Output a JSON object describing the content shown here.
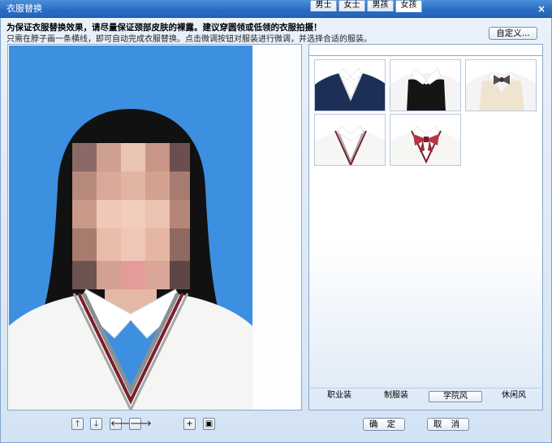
{
  "window": {
    "title": "衣服替换",
    "close_glyph": "×"
  },
  "hints": {
    "bold": "为保证衣服替换效果，请尽量保证颈部皮肤的裸露。建议穿圆领或低领的衣服拍摄！",
    "normal": "只需在脖子画一条横线，即可自动完成衣服替换。点击微调按钮对服装进行微调，并选择合适的服装。"
  },
  "custom_button": "自定义...",
  "tabs": [
    {
      "label": "男士",
      "active": false
    },
    {
      "label": "女士",
      "active": false
    },
    {
      "label": "男孩",
      "active": false
    },
    {
      "label": "女孩",
      "active": true
    }
  ],
  "thumbnails": [
    {
      "id": "navy-vest",
      "icon": "navy-vest-uniform-image"
    },
    {
      "id": "black-vest",
      "icon": "black-vest-uniform-image"
    },
    {
      "id": "beige-bow-vest",
      "icon": "beige-vest-bow-uniform-image"
    },
    {
      "id": "white-sweater-maroon",
      "icon": "white-sweater-uniform-image"
    },
    {
      "id": "white-bow-sweater",
      "icon": "white-sweater-bow-uniform-image"
    }
  ],
  "categories": [
    {
      "label": "职业装",
      "active": false
    },
    {
      "label": "制服装",
      "active": false
    },
    {
      "label": "学院风",
      "active": true
    },
    {
      "label": "休闲风",
      "active": false
    }
  ],
  "adjust_buttons": [
    {
      "name": "move-up-button",
      "glyph": "🡑"
    },
    {
      "name": "move-down-button",
      "glyph": "🡓"
    },
    {
      "name": "move-left-button",
      "glyph": "🡐"
    },
    {
      "name": "move-right-button",
      "glyph": "🡒"
    },
    {
      "name": "zoom-in-button",
      "glyph": "+"
    },
    {
      "name": "save-button",
      "glyph": "▣"
    }
  ],
  "actions": {
    "ok": "确 定",
    "cancel": "取 消"
  },
  "colors": {
    "photo_bg": "#3d8fe0",
    "accent": "#2a6cc4",
    "maroon": "#7b1f2a"
  }
}
